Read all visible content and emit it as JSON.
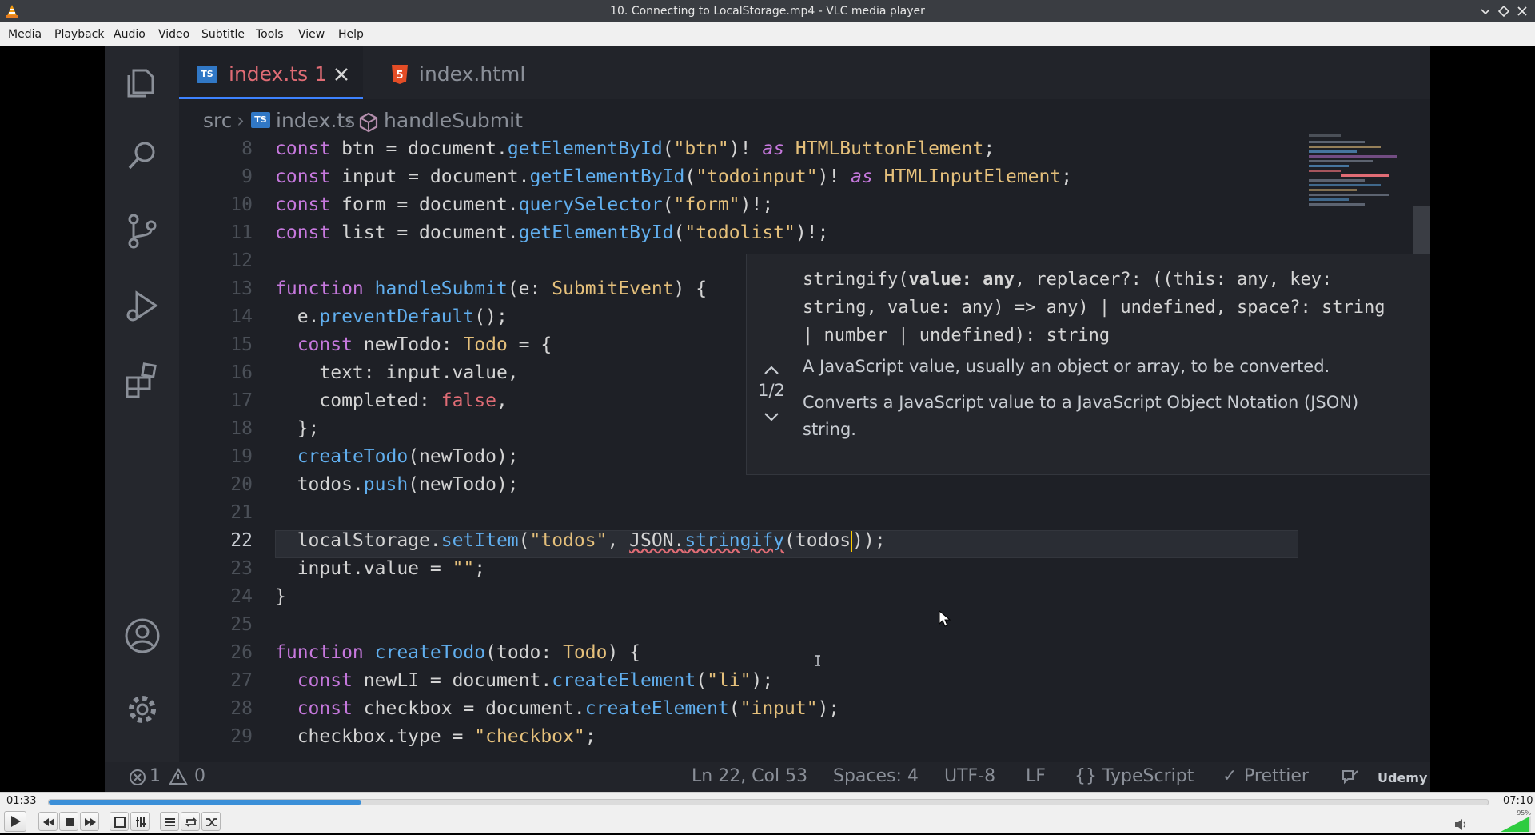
{
  "window": {
    "title": "10. Connecting to LocalStorage.mp4 - VLC media player"
  },
  "menu": [
    "Media",
    "Playback",
    "Audio",
    "Video",
    "Subtitle",
    "Tools",
    "View",
    "Help"
  ],
  "editor": {
    "tabs": [
      {
        "label": "index.ts",
        "badge": "TS",
        "problems": "1",
        "active": true
      },
      {
        "label": "index.html",
        "badge": "5",
        "active": false
      }
    ],
    "breadcrumb": {
      "folder": "src",
      "file": "index.ts",
      "symbol": "handleSubmit"
    },
    "lines": [
      {
        "num": "8"
      },
      {
        "num": "9"
      },
      {
        "num": "10"
      },
      {
        "num": "11"
      },
      {
        "num": "12"
      },
      {
        "num": "13"
      },
      {
        "num": "14"
      },
      {
        "num": "15"
      },
      {
        "num": "16"
      },
      {
        "num": "17"
      },
      {
        "num": "18"
      },
      {
        "num": "19"
      },
      {
        "num": "20"
      },
      {
        "num": "21"
      },
      {
        "num": "22"
      },
      {
        "num": "23"
      },
      {
        "num": "24"
      },
      {
        "num": "25"
      },
      {
        "num": "26"
      },
      {
        "num": "27"
      },
      {
        "num": "28"
      },
      {
        "num": "29"
      }
    ],
    "hover": {
      "signature_1": "stringify(",
      "signature_param": "value: any",
      "signature_2": ", replacer?: ((this: any, key:",
      "signature_3": "string, value: any) => any) | undefined, space?: string",
      "signature_4": "| number | undefined): string",
      "param_doc": "A JavaScript value, usually an object or array, to be converted.",
      "doc": "Converts a JavaScript value to a JavaScript Object Notation (JSON) string.",
      "overload": "1/2"
    },
    "status": {
      "errors": "1",
      "warnings": "0",
      "position": "Ln 22, Col 53",
      "spaces": "Spaces: 4",
      "encoding": "UTF-8",
      "eol": "LF",
      "language": "TypeScript",
      "formatter": "Prettier",
      "watermark": "Udemy"
    }
  },
  "player": {
    "elapsed": "01:33",
    "total": "07:10",
    "progress_fraction": 0.217,
    "volume_label": "95%",
    "volume_fraction": 0.95
  },
  "colors": {
    "accent": "#3b8fd8",
    "editor_bg": "#1e2026",
    "ts_blue": "#3178c6"
  }
}
